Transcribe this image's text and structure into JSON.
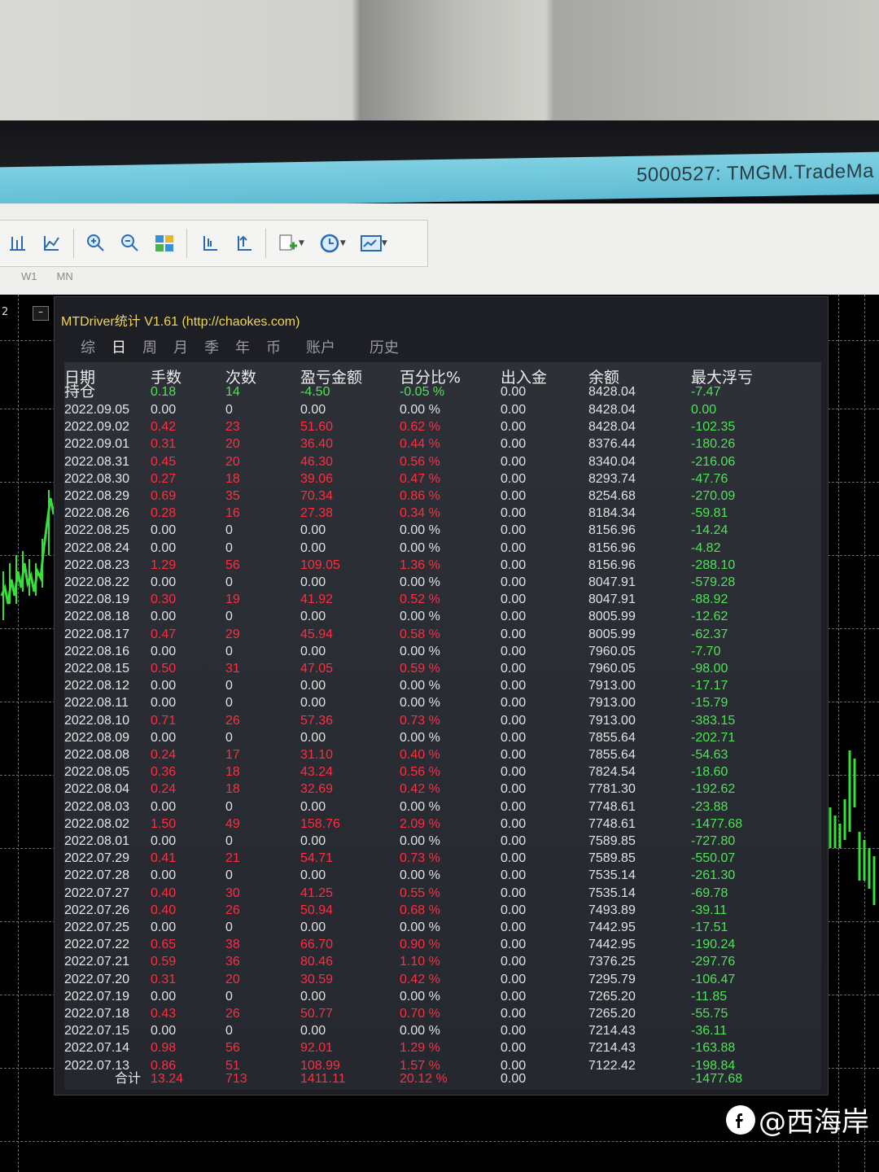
{
  "window": {
    "title": "5000527: TMGM.TradeMa"
  },
  "toolbar": {
    "periods": [
      "W1",
      "MN"
    ]
  },
  "chart": {
    "left_label": "2",
    "minimize_label": "–"
  },
  "panel": {
    "title": "MTDriver统计 V1.61  (http://chaokes.com)",
    "tabs": [
      "综",
      "日",
      "周",
      "月",
      "季",
      "年",
      "币",
      "账户",
      "历史"
    ],
    "active_tab": "日",
    "headers": {
      "date": "日期",
      "lots": "手数",
      "count": "次数",
      "pnl": "盈亏金额",
      "pct": "百分比%",
      "deposit": "出入金",
      "balance": "余额",
      "max_float": "最大浮亏"
    },
    "holding": {
      "label": "持仓",
      "lots": "0.18",
      "count": "14",
      "pnl": "-4.50",
      "pct": "-0.05 %",
      "deposit": "0.00",
      "balance": "8428.04",
      "max_float": "-7.47"
    },
    "rows": [
      {
        "date": "2022.09.05",
        "lots": "0.00",
        "count": "0",
        "pnl": "0.00",
        "pct": "0.00 %",
        "deposit": "0.00",
        "balance": "8428.04",
        "max_float": "0.00"
      },
      {
        "date": "2022.09.02",
        "lots": "0.42",
        "count": "23",
        "pnl": "51.60",
        "pct": "0.62 %",
        "deposit": "0.00",
        "balance": "8428.04",
        "max_float": "-102.35"
      },
      {
        "date": "2022.09.01",
        "lots": "0.31",
        "count": "20",
        "pnl": "36.40",
        "pct": "0.44 %",
        "deposit": "0.00",
        "balance": "8376.44",
        "max_float": "-180.26"
      },
      {
        "date": "2022.08.31",
        "lots": "0.45",
        "count": "20",
        "pnl": "46.30",
        "pct": "0.56 %",
        "deposit": "0.00",
        "balance": "8340.04",
        "max_float": "-216.06"
      },
      {
        "date": "2022.08.30",
        "lots": "0.27",
        "count": "18",
        "pnl": "39.06",
        "pct": "0.47 %",
        "deposit": "0.00",
        "balance": "8293.74",
        "max_float": "-47.76"
      },
      {
        "date": "2022.08.29",
        "lots": "0.69",
        "count": "35",
        "pnl": "70.34",
        "pct": "0.86 %",
        "deposit": "0.00",
        "balance": "8254.68",
        "max_float": "-270.09"
      },
      {
        "date": "2022.08.26",
        "lots": "0.28",
        "count": "16",
        "pnl": "27.38",
        "pct": "0.34 %",
        "deposit": "0.00",
        "balance": "8184.34",
        "max_float": "-59.81"
      },
      {
        "date": "2022.08.25",
        "lots": "0.00",
        "count": "0",
        "pnl": "0.00",
        "pct": "0.00 %",
        "deposit": "0.00",
        "balance": "8156.96",
        "max_float": "-14.24"
      },
      {
        "date": "2022.08.24",
        "lots": "0.00",
        "count": "0",
        "pnl": "0.00",
        "pct": "0.00 %",
        "deposit": "0.00",
        "balance": "8156.96",
        "max_float": "-4.82"
      },
      {
        "date": "2022.08.23",
        "lots": "1.29",
        "count": "56",
        "pnl": "109.05",
        "pct": "1.36 %",
        "deposit": "0.00",
        "balance": "8156.96",
        "max_float": "-288.10"
      },
      {
        "date": "2022.08.22",
        "lots": "0.00",
        "count": "0",
        "pnl": "0.00",
        "pct": "0.00 %",
        "deposit": "0.00",
        "balance": "8047.91",
        "max_float": "-579.28"
      },
      {
        "date": "2022.08.19",
        "lots": "0.30",
        "count": "19",
        "pnl": "41.92",
        "pct": "0.52 %",
        "deposit": "0.00",
        "balance": "8047.91",
        "max_float": "-88.92"
      },
      {
        "date": "2022.08.18",
        "lots": "0.00",
        "count": "0",
        "pnl": "0.00",
        "pct": "0.00 %",
        "deposit": "0.00",
        "balance": "8005.99",
        "max_float": "-12.62"
      },
      {
        "date": "2022.08.17",
        "lots": "0.47",
        "count": "29",
        "pnl": "45.94",
        "pct": "0.58 %",
        "deposit": "0.00",
        "balance": "8005.99",
        "max_float": "-62.37"
      },
      {
        "date": "2022.08.16",
        "lots": "0.00",
        "count": "0",
        "pnl": "0.00",
        "pct": "0.00 %",
        "deposit": "0.00",
        "balance": "7960.05",
        "max_float": "-7.70"
      },
      {
        "date": "2022.08.15",
        "lots": "0.50",
        "count": "31",
        "pnl": "47.05",
        "pct": "0.59 %",
        "deposit": "0.00",
        "balance": "7960.05",
        "max_float": "-98.00"
      },
      {
        "date": "2022.08.12",
        "lots": "0.00",
        "count": "0",
        "pnl": "0.00",
        "pct": "0.00 %",
        "deposit": "0.00",
        "balance": "7913.00",
        "max_float": "-17.17"
      },
      {
        "date": "2022.08.11",
        "lots": "0.00",
        "count": "0",
        "pnl": "0.00",
        "pct": "0.00 %",
        "deposit": "0.00",
        "balance": "7913.00",
        "max_float": "-15.79"
      },
      {
        "date": "2022.08.10",
        "lots": "0.71",
        "count": "26",
        "pnl": "57.36",
        "pct": "0.73 %",
        "deposit": "0.00",
        "balance": "7913.00",
        "max_float": "-383.15"
      },
      {
        "date": "2022.08.09",
        "lots": "0.00",
        "count": "0",
        "pnl": "0.00",
        "pct": "0.00 %",
        "deposit": "0.00",
        "balance": "7855.64",
        "max_float": "-202.71"
      },
      {
        "date": "2022.08.08",
        "lots": "0.24",
        "count": "17",
        "pnl": "31.10",
        "pct": "0.40 %",
        "deposit": "0.00",
        "balance": "7855.64",
        "max_float": "-54.63"
      },
      {
        "date": "2022.08.05",
        "lots": "0.36",
        "count": "18",
        "pnl": "43.24",
        "pct": "0.56 %",
        "deposit": "0.00",
        "balance": "7824.54",
        "max_float": "-18.60"
      },
      {
        "date": "2022.08.04",
        "lots": "0.24",
        "count": "18",
        "pnl": "32.69",
        "pct": "0.42 %",
        "deposit": "0.00",
        "balance": "7781.30",
        "max_float": "-192.62"
      },
      {
        "date": "2022.08.03",
        "lots": "0.00",
        "count": "0",
        "pnl": "0.00",
        "pct": "0.00 %",
        "deposit": "0.00",
        "balance": "7748.61",
        "max_float": "-23.88"
      },
      {
        "date": "2022.08.02",
        "lots": "1.50",
        "count": "49",
        "pnl": "158.76",
        "pct": "2.09 %",
        "deposit": "0.00",
        "balance": "7748.61",
        "max_float": "-1477.68"
      },
      {
        "date": "2022.08.01",
        "lots": "0.00",
        "count": "0",
        "pnl": "0.00",
        "pct": "0.00 %",
        "deposit": "0.00",
        "balance": "7589.85",
        "max_float": "-727.80"
      },
      {
        "date": "2022.07.29",
        "lots": "0.41",
        "count": "21",
        "pnl": "54.71",
        "pct": "0.73 %",
        "deposit": "0.00",
        "balance": "7589.85",
        "max_float": "-550.07"
      },
      {
        "date": "2022.07.28",
        "lots": "0.00",
        "count": "0",
        "pnl": "0.00",
        "pct": "0.00 %",
        "deposit": "0.00",
        "balance": "7535.14",
        "max_float": "-261.30"
      },
      {
        "date": "2022.07.27",
        "lots": "0.40",
        "count": "30",
        "pnl": "41.25",
        "pct": "0.55 %",
        "deposit": "0.00",
        "balance": "7535.14",
        "max_float": "-69.78"
      },
      {
        "date": "2022.07.26",
        "lots": "0.40",
        "count": "26",
        "pnl": "50.94",
        "pct": "0.68 %",
        "deposit": "0.00",
        "balance": "7493.89",
        "max_float": "-39.11"
      },
      {
        "date": "2022.07.25",
        "lots": "0.00",
        "count": "0",
        "pnl": "0.00",
        "pct": "0.00 %",
        "deposit": "0.00",
        "balance": "7442.95",
        "max_float": "-17.51"
      },
      {
        "date": "2022.07.22",
        "lots": "0.65",
        "count": "38",
        "pnl": "66.70",
        "pct": "0.90 %",
        "deposit": "0.00",
        "balance": "7442.95",
        "max_float": "-190.24"
      },
      {
        "date": "2022.07.21",
        "lots": "0.59",
        "count": "36",
        "pnl": "80.46",
        "pct": "1.10 %",
        "deposit": "0.00",
        "balance": "7376.25",
        "max_float": "-297.76"
      },
      {
        "date": "2022.07.20",
        "lots": "0.31",
        "count": "20",
        "pnl": "30.59",
        "pct": "0.42 %",
        "deposit": "0.00",
        "balance": "7295.79",
        "max_float": "-106.47"
      },
      {
        "date": "2022.07.19",
        "lots": "0.00",
        "count": "0",
        "pnl": "0.00",
        "pct": "0.00 %",
        "deposit": "0.00",
        "balance": "7265.20",
        "max_float": "-11.85"
      },
      {
        "date": "2022.07.18",
        "lots": "0.43",
        "count": "26",
        "pnl": "50.77",
        "pct": "0.70 %",
        "deposit": "0.00",
        "balance": "7265.20",
        "max_float": "-55.75"
      },
      {
        "date": "2022.07.15",
        "lots": "0.00",
        "count": "0",
        "pnl": "0.00",
        "pct": "0.00 %",
        "deposit": "0.00",
        "balance": "7214.43",
        "max_float": "-36.11"
      },
      {
        "date": "2022.07.14",
        "lots": "0.98",
        "count": "56",
        "pnl": "92.01",
        "pct": "1.29 %",
        "deposit": "0.00",
        "balance": "7214.43",
        "max_float": "-163.88"
      },
      {
        "date": "2022.07.13",
        "lots": "0.86",
        "count": "51",
        "pnl": "108.99",
        "pct": "1.57 %",
        "deposit": "0.00",
        "balance": "7122.42",
        "max_float": "-198.84"
      }
    ],
    "total": {
      "label": "合计",
      "lots": "13.24",
      "count": "713",
      "pnl": "1411.11",
      "pct": "20.12 %",
      "deposit": "0.00",
      "max_float": "-1477.68"
    }
  },
  "watermark": {
    "text": "@西海岸"
  },
  "colors": {
    "positive": "#ff2d3f",
    "drawdown": "#4ee356",
    "neutral": "#e2e2e2",
    "title": "#f0d657"
  }
}
